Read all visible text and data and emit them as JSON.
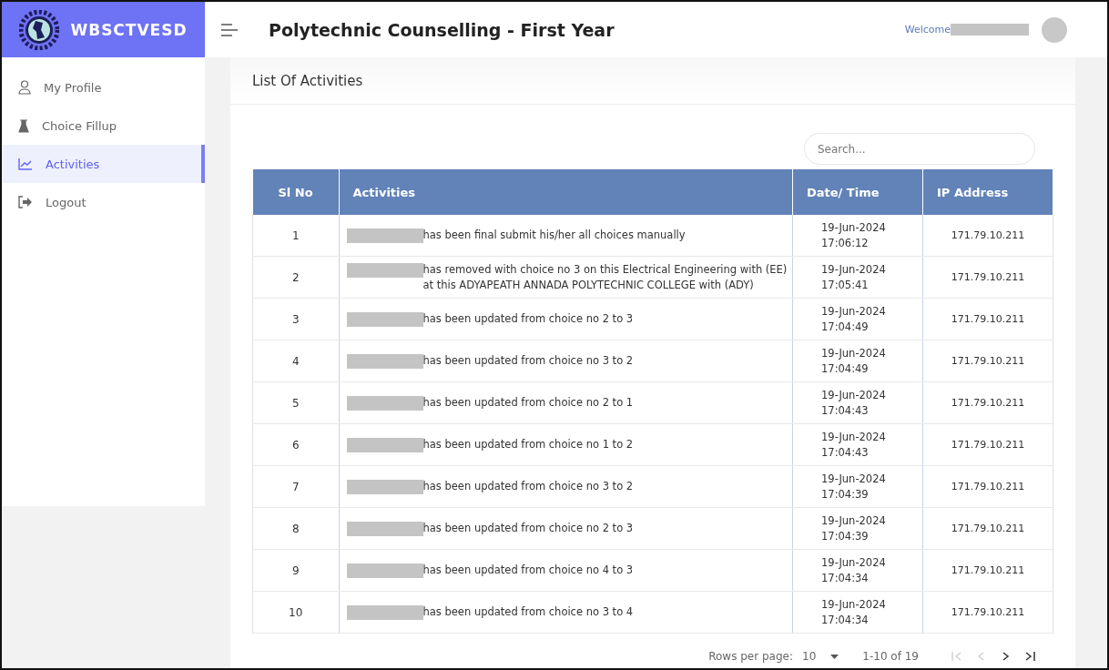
{
  "brand": {
    "name": "WBSCTVESD"
  },
  "header": {
    "title": "Polytechnic Counselling - First Year",
    "welcome": "Welcome"
  },
  "sidebar": {
    "items": [
      {
        "label": "My Profile",
        "kind": "profile",
        "selected": false
      },
      {
        "label": "Choice Fillup",
        "kind": "choice",
        "selected": false
      },
      {
        "label": "Activities",
        "kind": "activities",
        "selected": true
      },
      {
        "label": "Logout",
        "kind": "logout",
        "selected": false
      }
    ]
  },
  "page": {
    "title": "List Of Activities"
  },
  "search": {
    "placeholder": "Search..."
  },
  "table": {
    "columns": [
      "Sl No",
      "Activities",
      "Date/ Time",
      "IP Address"
    ],
    "rows": [
      {
        "sl": "1",
        "activity": "has been final submit his/her all choices manually",
        "date": "19-Jun-2024",
        "time": "17:06:12",
        "ip": "171.79.10.211"
      },
      {
        "sl": "2",
        "activity": "has removed with choice no 3 on this Electrical Engineering with (EE) at this ADYAPEATH ANNADA POLYTECHNIC COLLEGE with (ADY)",
        "date": "19-Jun-2024",
        "time": "17:05:41",
        "ip": "171.79.10.211"
      },
      {
        "sl": "3",
        "activity": "has been updated from choice no 2 to 3",
        "date": "19-Jun-2024",
        "time": "17:04:49",
        "ip": "171.79.10.211"
      },
      {
        "sl": "4",
        "activity": "has been updated from choice no 3 to 2",
        "date": "19-Jun-2024",
        "time": "17:04:49",
        "ip": "171.79.10.211"
      },
      {
        "sl": "5",
        "activity": "has been updated from choice no 2 to 1",
        "date": "19-Jun-2024",
        "time": "17:04:43",
        "ip": "171.79.10.211"
      },
      {
        "sl": "6",
        "activity": "has been updated from choice no 1 to 2",
        "date": "19-Jun-2024",
        "time": "17:04:43",
        "ip": "171.79.10.211"
      },
      {
        "sl": "7",
        "activity": "has been updated from choice no 3 to 2",
        "date": "19-Jun-2024",
        "time": "17:04:39",
        "ip": "171.79.10.211"
      },
      {
        "sl": "8",
        "activity": "has been updated from choice no 2 to 3",
        "date": "19-Jun-2024",
        "time": "17:04:39",
        "ip": "171.79.10.211"
      },
      {
        "sl": "9",
        "activity": "has been updated from choice no 4 to 3",
        "date": "19-Jun-2024",
        "time": "17:04:34",
        "ip": "171.79.10.211"
      },
      {
        "sl": "10",
        "activity": "has been updated from choice no 3 to 4",
        "date": "19-Jun-2024",
        "time": "17:04:34",
        "ip": "171.79.10.211"
      }
    ]
  },
  "pagination": {
    "rows_label": "Rows per page:",
    "rows_value": "10",
    "range": "1-10 of 19"
  }
}
